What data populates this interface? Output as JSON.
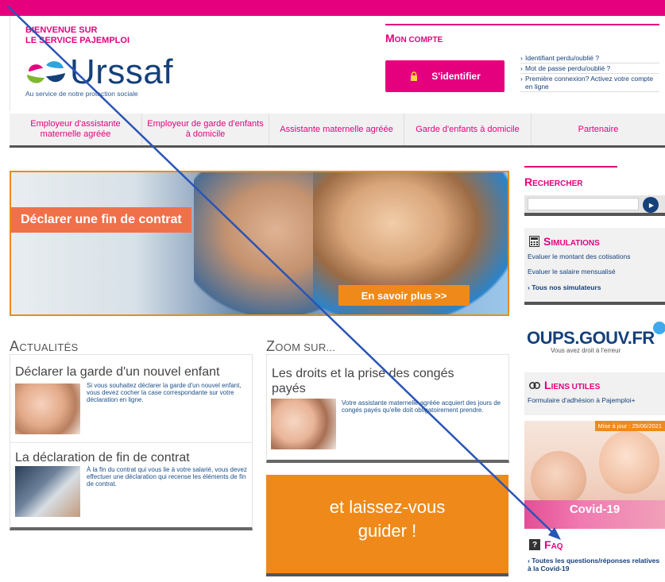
{
  "header": {
    "welcome_line1": "BIENVENUE SUR",
    "welcome_line2": "LE SERVICE PAJEMPLOI",
    "logo_word": "Urssaf",
    "logo_tagline": "Au service de notre protection sociale"
  },
  "account": {
    "title_first": "M",
    "title_rest": "ON COMPTE",
    "login_label": "S'identifier",
    "links": [
      "Identifiant perdu/oublié ?",
      "Mot de passe perdu/oublié ?",
      "Première connexion? Activez votre compte en ligne"
    ]
  },
  "nav": {
    "items": [
      "Employeur d'assistante maternelle agréée",
      "Employeur de garde d'enfants à domicile",
      "Assistante maternelle agréée",
      "Garde d'enfants à domicile",
      "Partenaire"
    ]
  },
  "hero": {
    "label": "Déclarer une fin de contrat",
    "more": "En savoir plus >>"
  },
  "actualites": {
    "title_first": "A",
    "title_rest": "CTUALITÉS",
    "items": [
      {
        "title": "Déclarer la garde d'un nouvel enfant",
        "text": "Si vous souhaitez déclarer la garde d'un nouvel enfant, vous devez cocher la case correspondante sur votre déclaration en ligne."
      },
      {
        "title": "La déclaration de fin de contrat",
        "text": "À la fin du contrat qui vous lie à votre salarié, vous devez effectuer une déclaration qui recense les éléments de fin de contrat."
      }
    ]
  },
  "zoom": {
    "title_first": "Z",
    "title_rest": "OOM SUR...",
    "item_title": "Les droits et la prise des congés payés",
    "item_text": "Votre assistante maternelle agréée acquiert des jours de congés payés qu'elle doit obligatoirement prendre.",
    "promo_text": "et laissez-vous guider !"
  },
  "sidebar": {
    "search_title_first": "R",
    "search_title_rest": "ECHERCHER",
    "search_button": "▶",
    "simulations_title_first": "S",
    "simulations_title_rest": "IMULATIONS",
    "simulations_links": [
      "Evaluer le montant des cotisations",
      "Evaluer le salaire mensualisé",
      "Tous nos simulateurs"
    ],
    "oups_word": "OUPS.GOUV.FR",
    "oups_sub": "Vous avez droit à l'erreur",
    "liens_title_first": "L",
    "liens_title_rest": "IENS UTILES",
    "liens_link": "Formulaire d'adhésion à Pajemploi+",
    "covid_date": "Mise à jour : 25/06/2021",
    "covid_label": "Covid-19",
    "faq_title_first": "F",
    "faq_title_rest": "AQ",
    "faq_link": "Toutes les questions/réponses relatives à la Covid-19"
  },
  "colors": {
    "brand_pink": "#e5007e",
    "brand_orange": "#ef8a1a",
    "brand_navy": "#15407a",
    "annotation_arrow": "#2a55b5"
  }
}
